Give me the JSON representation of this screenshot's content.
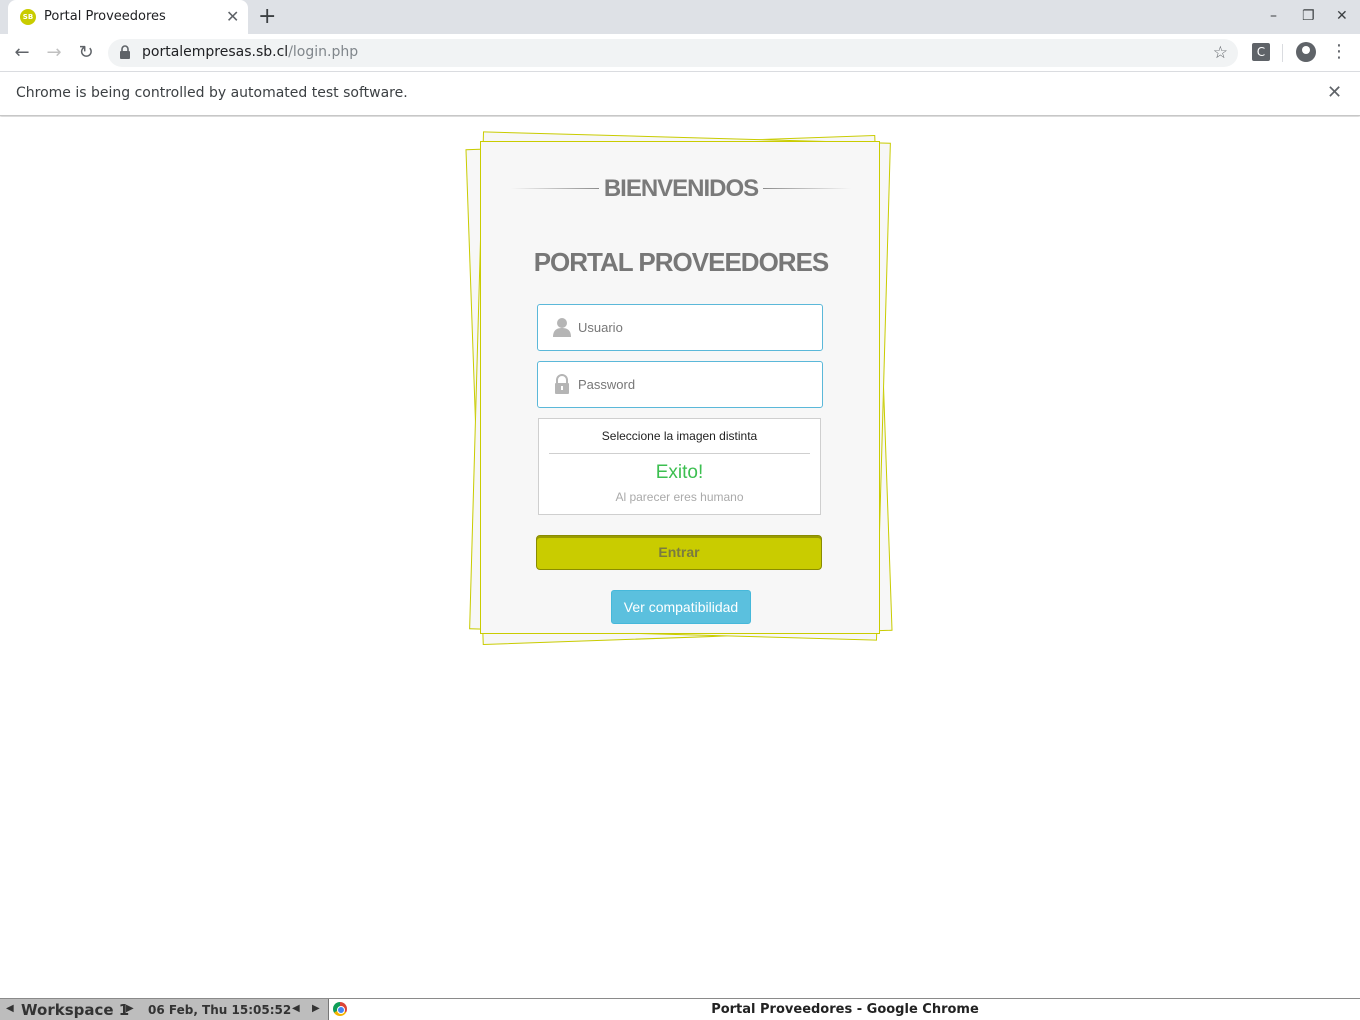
{
  "browser": {
    "tab_title": "Portal Proveedores",
    "tab_favicon_text": "SB",
    "url_host": "portalempresas.sb.cl",
    "url_path": "/login.php",
    "extension_label": "C",
    "infobar_text": "Chrome is being controlled by automated test software."
  },
  "page": {
    "welcome": "BIENVENIDOS",
    "portal_title": "PORTAL PROVEEDORES",
    "username_placeholder": "Usuario",
    "password_placeholder": "Password",
    "captcha": {
      "title": "Seleccione la imagen distinta",
      "success": "Exito!",
      "note": "Al parecer eres humano"
    },
    "enter_button": "Entrar",
    "compat_button": "Ver compatibilidad"
  },
  "taskbar": {
    "workspace": "Workspace 1",
    "clock": "06 Feb, Thu 15:05:52",
    "task_title": "Portal Proveedores - Google Chrome"
  },
  "colors": {
    "accent": "#c9cc00",
    "field_border": "#5bb8d9",
    "success": "#3cbf50",
    "info_button": "#5bc0de"
  }
}
